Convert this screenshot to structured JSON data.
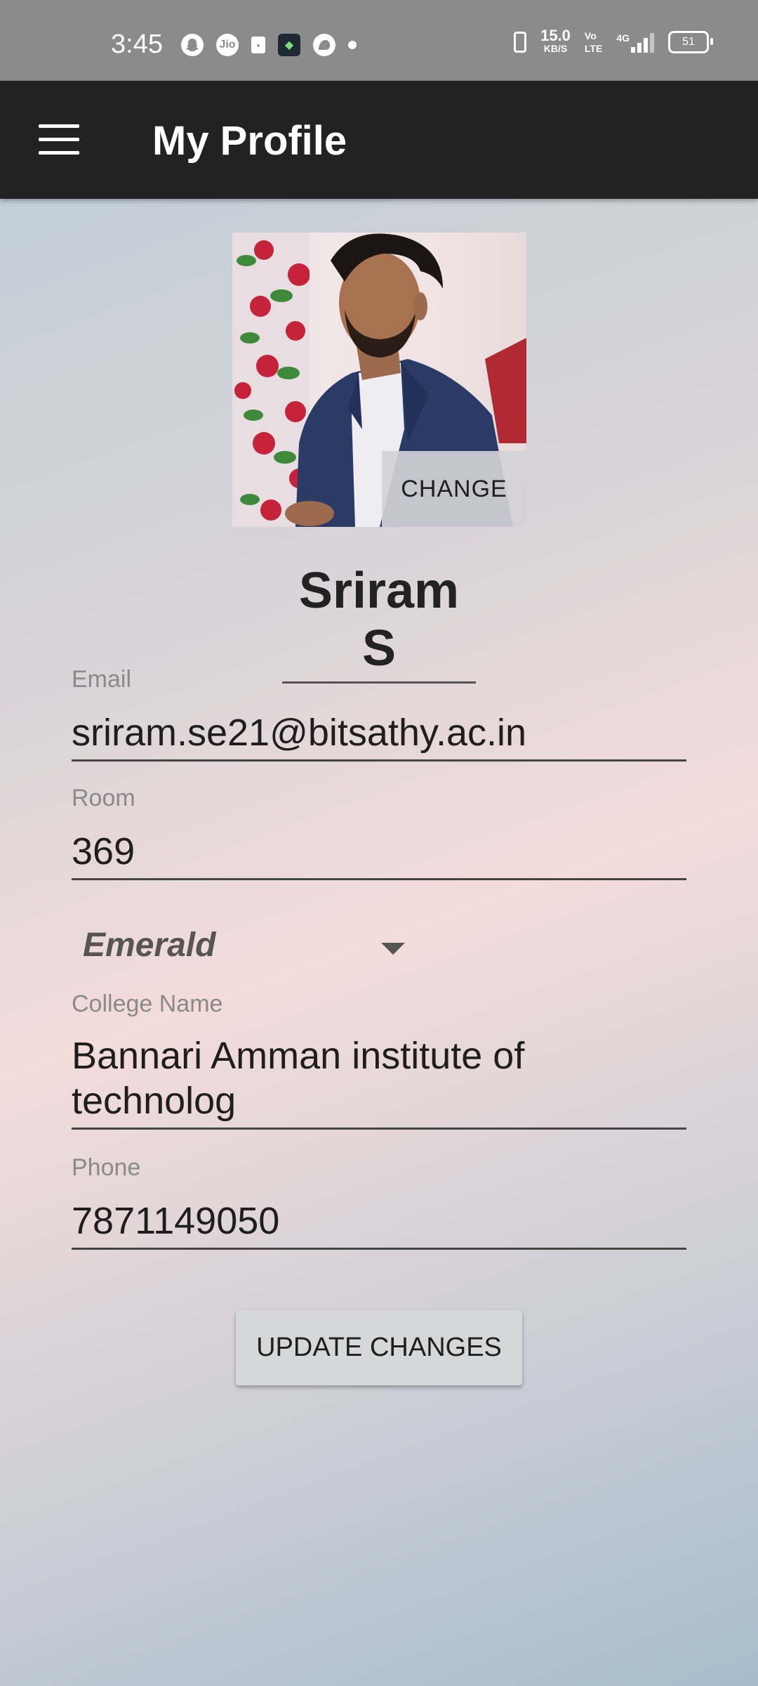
{
  "status_bar": {
    "time": "3:45",
    "network_speed_value": "15.0",
    "network_speed_unit": "KB/S",
    "volte_top": "Vo",
    "volte_bottom": "LTE",
    "network_type": "4G",
    "battery": "51",
    "app_icons": [
      "snapchat-icon",
      "jio-icon",
      "calendar-icon",
      "shield-app-icon",
      "notification-app-icon"
    ]
  },
  "app_bar": {
    "title": "My Profile",
    "menu_icon": "hamburger-menu-icon"
  },
  "profile": {
    "change_photo_label": "CHANGE",
    "name": "Sriram S"
  },
  "form": {
    "email": {
      "label": "Email",
      "value": "sriram.se21@bitsathy.ac.in"
    },
    "room": {
      "label": "Room",
      "value": "369"
    },
    "block": {
      "selected": "Emerald"
    },
    "college": {
      "label": "College Name",
      "value": "Bannari Amman institute of technolog"
    },
    "phone": {
      "label": "Phone",
      "value": "7871149050"
    }
  },
  "actions": {
    "update_label": "UPDATE CHANGES"
  },
  "colors": {
    "app_bar": "#222222",
    "status_bar": "#8b8b8b",
    "button": "#d6d7d8"
  }
}
